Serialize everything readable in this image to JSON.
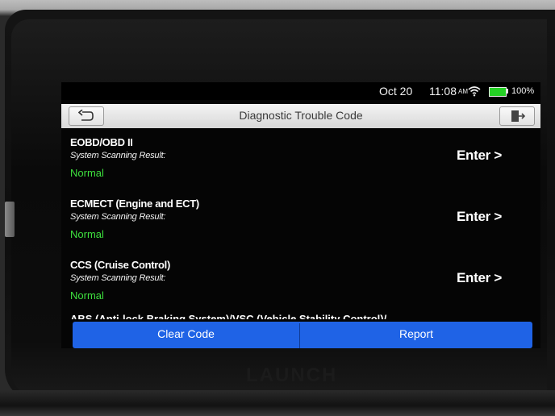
{
  "status_bar": {
    "date": "Oct 20",
    "time": "11:08",
    "ampm": "AM",
    "battery": "100%",
    "battery_color": "#25d025"
  },
  "header": {
    "title": "Diagnostic Trouble Code",
    "back_icon": "back-arrow-icon",
    "exit_icon": "exit-door-icon"
  },
  "systems": [
    {
      "name": "EOBD/OBD II",
      "result_label": "System Scanning Result:",
      "status": "Normal",
      "action": "Enter >"
    },
    {
      "name": "ECMECT (Engine and ECT)",
      "result_label": "System Scanning Result:",
      "status": "Normal",
      "action": "Enter >"
    },
    {
      "name": "CCS (Cruise Control)",
      "result_label": "System Scanning Result:",
      "status": "Normal",
      "action": "Enter >"
    }
  ],
  "partial_item": "ABS (Anti-lock Braking System)/VSC (Vehicle Stability Control)/",
  "bottom_bar": {
    "clear_code": "Clear Code",
    "report": "Report",
    "color": "#1f63e6"
  },
  "brand": "LAUNCH",
  "status_color": "#3ee03e"
}
